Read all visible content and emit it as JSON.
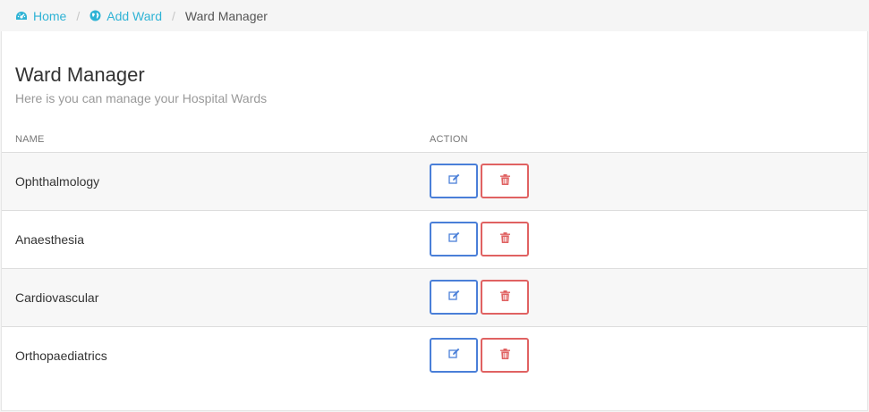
{
  "breadcrumb": {
    "items": [
      {
        "label": "Home",
        "icon": "dashboard-icon"
      },
      {
        "label": "Add Ward",
        "icon": "globe-icon"
      },
      {
        "label": "Ward Manager"
      }
    ]
  },
  "page": {
    "title": "Ward Manager",
    "subtitle": "Here is you can manage your Hospital Wards"
  },
  "table": {
    "columns": [
      "NAME",
      "ACTION"
    ],
    "rows": [
      {
        "name": "Ophthalmology"
      },
      {
        "name": "Anaesthesia"
      },
      {
        "name": "Cardiovascular"
      },
      {
        "name": "Orthopaediatrics"
      }
    ]
  },
  "colors": {
    "link": "#2fb3d5",
    "edit": "#4a7fd8",
    "delete": "#e06262"
  }
}
